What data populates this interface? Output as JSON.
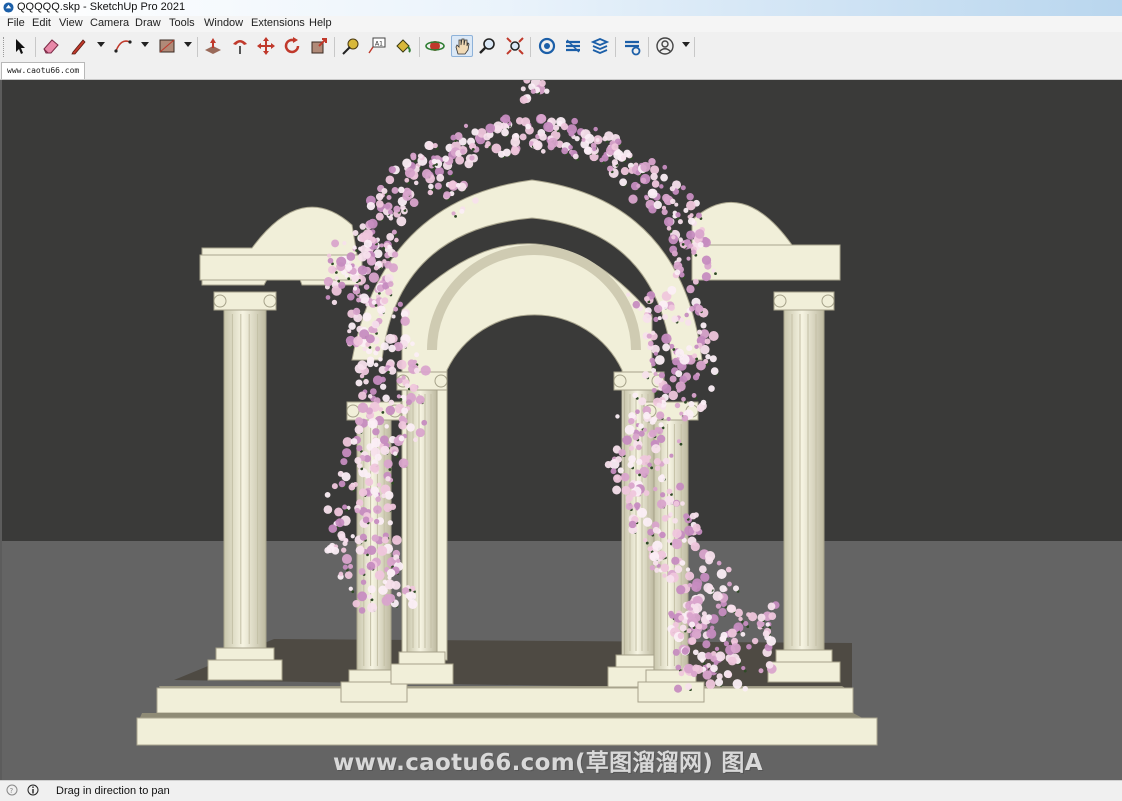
{
  "window": {
    "title": "QQQQQ.skp - SketchUp Pro 2021"
  },
  "menu": [
    "File",
    "Edit",
    "View",
    "Camera",
    "Draw",
    "Tools",
    "Window",
    "Extensions",
    "Help"
  ],
  "toolbar": {
    "tools": [
      {
        "name": "select-icon"
      },
      {
        "name": "eraser-icon"
      },
      {
        "name": "pencil-line-icon"
      },
      {
        "name": "arc-icon"
      },
      {
        "name": "rectangle-icon"
      },
      {
        "name": "push-pull-icon"
      },
      {
        "name": "follow-me-icon"
      },
      {
        "name": "move-icon"
      },
      {
        "name": "rotate-icon"
      },
      {
        "name": "scale-icon"
      },
      {
        "name": "tape-measure-icon"
      },
      {
        "name": "text-icon"
      },
      {
        "name": "paint-bucket-icon"
      },
      {
        "name": "orbit-icon"
      },
      {
        "name": "pan-icon",
        "active": true
      },
      {
        "name": "zoom-icon"
      },
      {
        "name": "zoom-extents-icon"
      },
      {
        "name": "warehouse-icon"
      },
      {
        "name": "extension-warehouse-icon"
      },
      {
        "name": "layout-icon"
      },
      {
        "name": "extension-manager-icon"
      },
      {
        "name": "account-icon"
      }
    ]
  },
  "scene_tab": {
    "label": "www.caotu66.com"
  },
  "viewport": {
    "background": "#3a3a39",
    "ground_color": "#646464",
    "model_color": "#f1efd9",
    "flower_colors": [
      "#f7e0ec",
      "#efc6dc",
      "#d9a4cc",
      "#c68cc0",
      "#fbeef5"
    ],
    "watermark": "www.caotu66.com(草图溜溜网) 图A"
  },
  "status": {
    "text": "Drag in direction to pan"
  }
}
